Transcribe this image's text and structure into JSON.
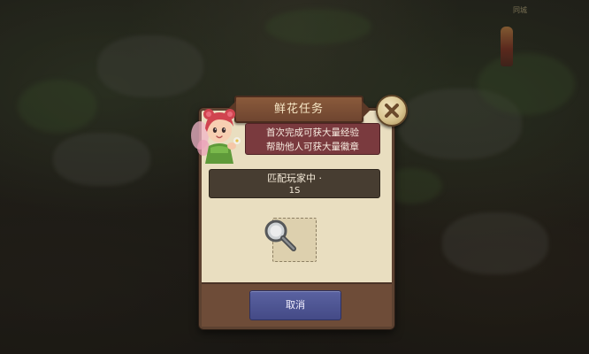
{
  "background": {
    "corner_label": "同城"
  },
  "dialog": {
    "title": "鲜花任务",
    "info_line1": "首次完成可获大量经验",
    "info_line2": "帮助他人可获大量徽章",
    "status_text": "匹配玩家中 ·",
    "status_timer": "1S",
    "cancel_label": "取消"
  },
  "colors": {
    "dialog_body": "#e9dec0",
    "dialog_footer": "#6e4c38",
    "info_box": "#7a3a3e",
    "status_box": "#473d31",
    "cancel_button": "#4a5190"
  },
  "icons": {
    "close": "close-icon",
    "search": "magnifier-icon",
    "character": "fairy-avatar"
  }
}
